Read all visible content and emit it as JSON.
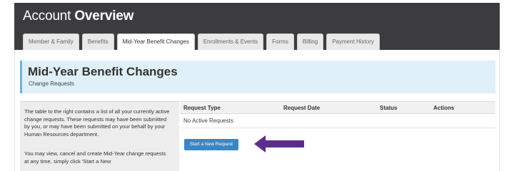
{
  "header": {
    "title_prefix": "Account ",
    "title_strong": "Overview"
  },
  "tabs": [
    {
      "label": "Member & Family",
      "active": false
    },
    {
      "label": "Benefits",
      "active": false
    },
    {
      "label": "Mid-Year Benefit Changes",
      "active": true
    },
    {
      "label": "Enrollments & Events",
      "active": false
    },
    {
      "label": "Forms",
      "active": false
    },
    {
      "label": "Billing",
      "active": false
    },
    {
      "label": "Payment History",
      "active": false
    }
  ],
  "page": {
    "title": "Mid-Year Benefit Changes",
    "subtitle": "Change Requests"
  },
  "info": {
    "paragraph1": "The table to the right contains a list of all your currently active change requests. These requests may have been submitted by you, or may have been submitted on your behalf by your Human Resources department.",
    "paragraph2": "You may view, cancel and create Mid-Year change requests at any time, simply click 'Start a New"
  },
  "table": {
    "columns": [
      "Request Type",
      "Request Date",
      "Status",
      "Actions"
    ],
    "empty_message": "No Active Requests"
  },
  "actions": {
    "start_label": "Start a New Request"
  },
  "colors": {
    "topbar": "#3c3c3e",
    "header_bg": "#dff0f8",
    "header_accent": "#66b7dd",
    "button": "#3b86c6",
    "arrow": "#5b2d8e"
  },
  "icons": {
    "arrow": "left-arrow-icon"
  }
}
